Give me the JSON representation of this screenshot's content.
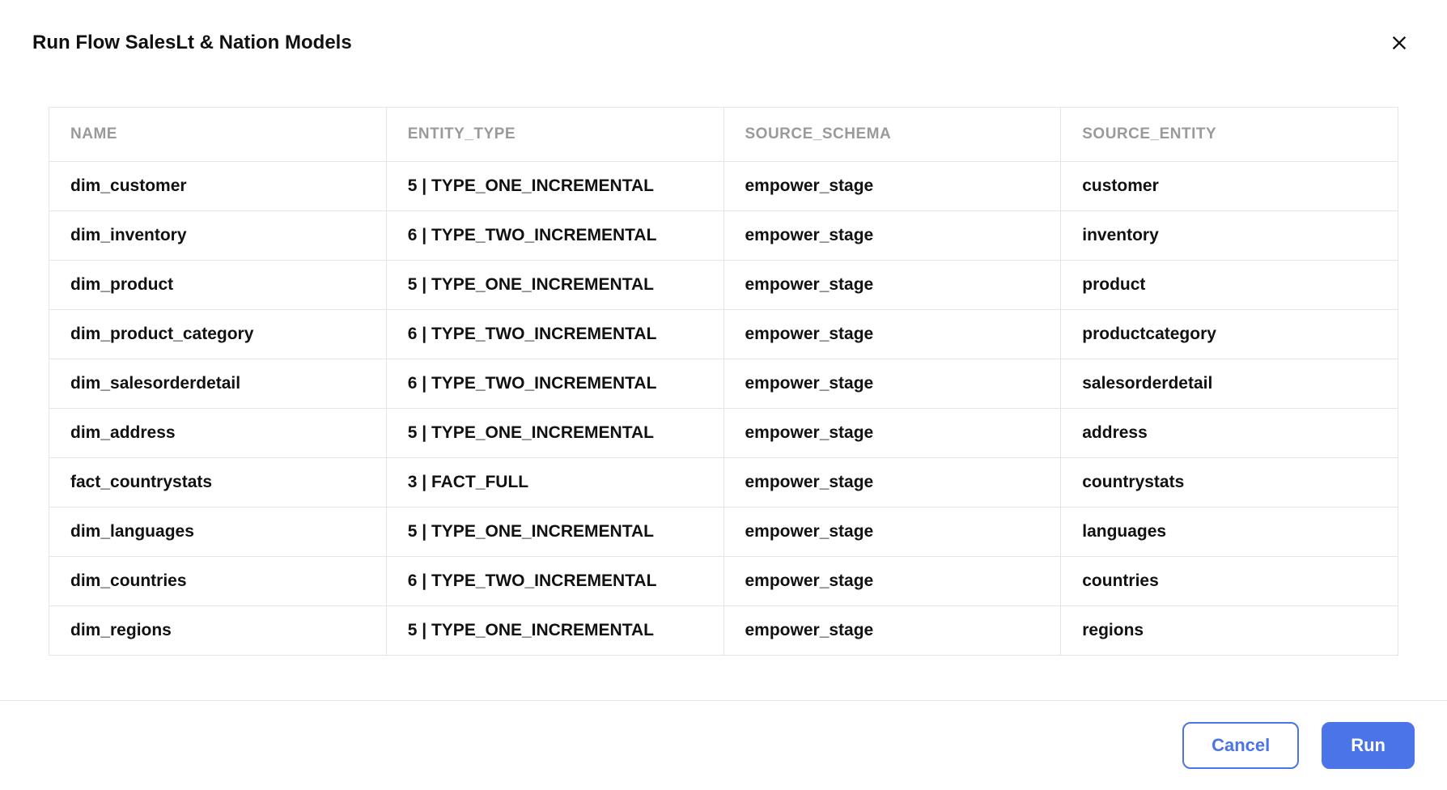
{
  "header": {
    "title": "Run Flow SalesLt & Nation Models"
  },
  "table": {
    "columns": {
      "name": "NAME",
      "entity_type": "ENTITY_TYPE",
      "source_schema": "SOURCE_SCHEMA",
      "source_entity": "SOURCE_ENTITY"
    },
    "rows": [
      {
        "name": "dim_customer",
        "entity_type": "5 | TYPE_ONE_INCREMENTAL",
        "source_schema": "empower_stage",
        "source_entity": "customer"
      },
      {
        "name": "dim_inventory",
        "entity_type": "6 | TYPE_TWO_INCREMENTAL",
        "source_schema": "empower_stage",
        "source_entity": "inventory"
      },
      {
        "name": "dim_product",
        "entity_type": "5 | TYPE_ONE_INCREMENTAL",
        "source_schema": "empower_stage",
        "source_entity": "product"
      },
      {
        "name": "dim_product_category",
        "entity_type": "6 | TYPE_TWO_INCREMENTAL",
        "source_schema": "empower_stage",
        "source_entity": "productcategory"
      },
      {
        "name": "dim_salesorderdetail",
        "entity_type": "6 | TYPE_TWO_INCREMENTAL",
        "source_schema": "empower_stage",
        "source_entity": "salesorderdetail"
      },
      {
        "name": "dim_address",
        "entity_type": "5 | TYPE_ONE_INCREMENTAL",
        "source_schema": "empower_stage",
        "source_entity": "address"
      },
      {
        "name": "fact_countrystats",
        "entity_type": "3 | FACT_FULL",
        "source_schema": "empower_stage",
        "source_entity": "countrystats"
      },
      {
        "name": "dim_languages",
        "entity_type": "5 | TYPE_ONE_INCREMENTAL",
        "source_schema": "empower_stage",
        "source_entity": "languages"
      },
      {
        "name": "dim_countries",
        "entity_type": "6 | TYPE_TWO_INCREMENTAL",
        "source_schema": "empower_stage",
        "source_entity": "countries"
      },
      {
        "name": "dim_regions",
        "entity_type": "5 | TYPE_ONE_INCREMENTAL",
        "source_schema": "empower_stage",
        "source_entity": "regions"
      }
    ]
  },
  "footer": {
    "cancel_label": "Cancel",
    "run_label": "Run"
  }
}
